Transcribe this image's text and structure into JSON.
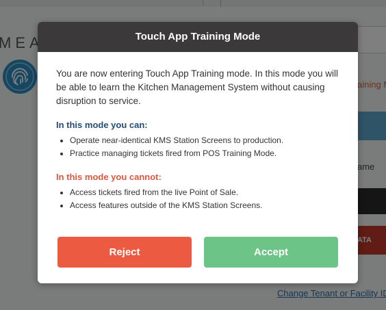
{
  "background": {
    "brand_text": "MEA",
    "training_text": "aining M",
    "name_text": "ame",
    "red_button_text": "ATA",
    "footer_link": "Change Tenant or Facility ID"
  },
  "modal": {
    "title": "Touch App Training Mode",
    "intro": "You are now entering Touch App Training mode. In this mode you will be able to learn the Kitchen Management System without causing disruption to service.",
    "can_title": "In this mode you can:",
    "can_items": [
      "Operate near-identical KMS Station Screens to production.",
      "Practice managing tickets fired from POS Training Mode."
    ],
    "cannot_title": "In this mode you cannot:",
    "cannot_items": [
      "Access tickets fired from the live Point of Sale.",
      "Access features outside of the KMS Station Screens."
    ],
    "reject_label": "Reject",
    "accept_label": "Accept"
  },
  "colors": {
    "header_bg": "#3b3939",
    "can_title": "#1f4d7a",
    "cannot_title": "#e0563b",
    "reject": "#ec5b41",
    "accept": "#6cc486"
  },
  "icons": [
    "fingerprint-icon"
  ]
}
